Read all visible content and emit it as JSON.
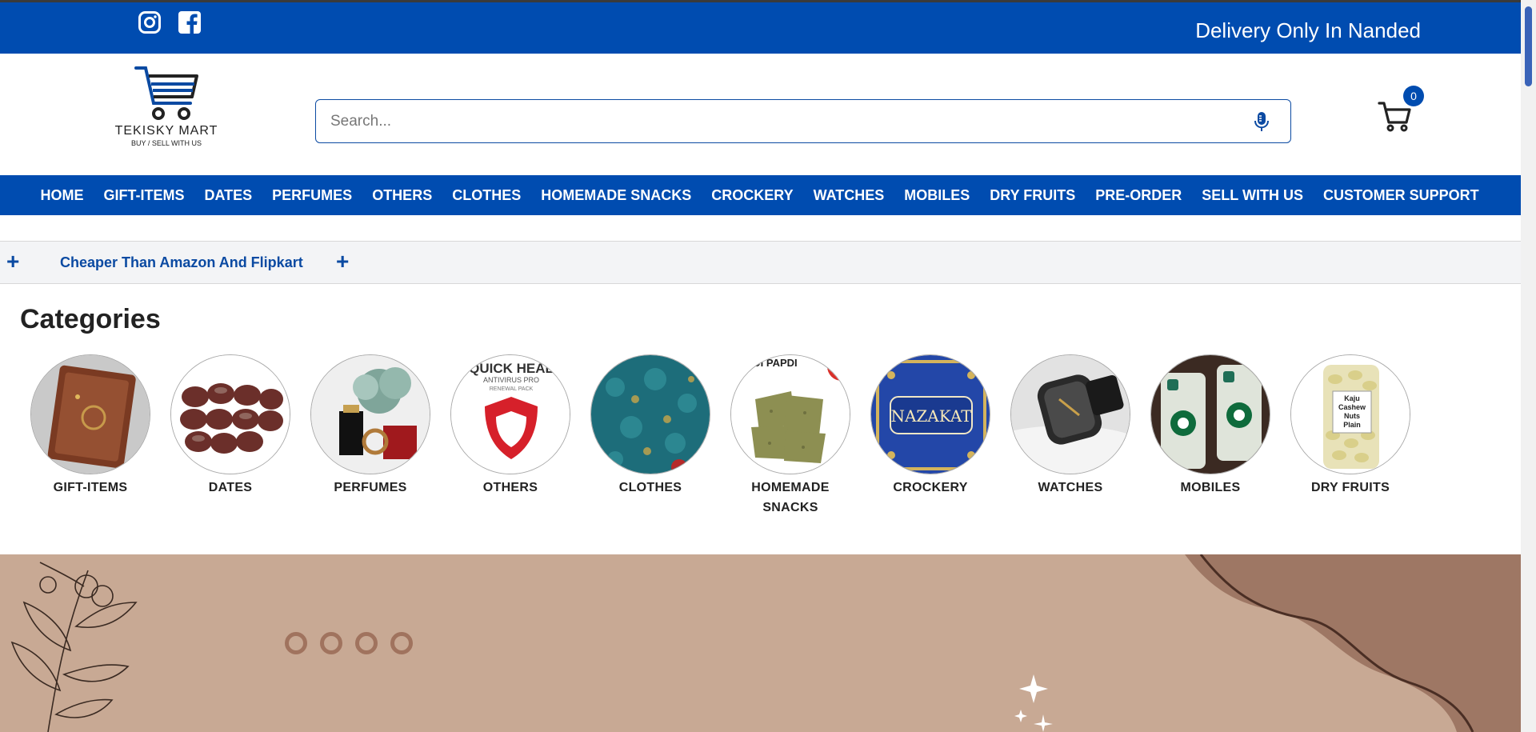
{
  "topbar": {
    "delivery_text": "Delivery Only In Nanded",
    "social_icons": [
      "instagram-icon",
      "facebook-icon"
    ],
    "color": "#004cb0"
  },
  "logo": {
    "name": "TEKISKY MART",
    "tagline": "BUY / SELL WITH US"
  },
  "search": {
    "placeholder": "Search...",
    "value": "",
    "icon": "microphone-icon"
  },
  "cart": {
    "count": "0",
    "icon": "shopping-cart-icon"
  },
  "nav": {
    "items": [
      "HOME",
      "GIFT-ITEMS",
      "DATES",
      "PERFUMES",
      "OTHERS",
      "CLOTHES",
      "HOMEMADE SNACKS",
      "CROCKERY",
      "WATCHES",
      "MOBILES",
      "DRY FRUITS",
      "PRE-ORDER",
      "SELL WITH US",
      "CUSTOMER SUPPORT"
    ]
  },
  "promo": {
    "text": "Cheaper Than Amazon And Flipkart",
    "left_icon": "+",
    "right_icon": "+"
  },
  "categories": {
    "title": "Categories",
    "items": [
      {
        "label": "GIFT-ITEMS",
        "label2": ""
      },
      {
        "label": "DATES",
        "label2": ""
      },
      {
        "label": "PERFUMES",
        "label2": ""
      },
      {
        "label": "OTHERS",
        "label2": "",
        "image_text": "QUICK HEAL",
        "image_subtext": "ANTIVIRUS PRO",
        "image_subtext2": "RENEWAL PACK"
      },
      {
        "label": "CLOTHES",
        "label2": ""
      },
      {
        "label": "HOMEMADE",
        "label2": "SNACKS",
        "image_text": "DI PAPDI"
      },
      {
        "label": "CROCKERY",
        "label2": "",
        "image_text": "NAZAKAT"
      },
      {
        "label": "WATCHES",
        "label2": ""
      },
      {
        "label": "MOBILES",
        "label2": ""
      },
      {
        "label": "DRY FRUITS",
        "label2": "",
        "image_text": "Kaju",
        "image_subtext": "Cashew",
        "image_subtext2": "Nuts",
        "image_subtext3": "Plain"
      }
    ]
  },
  "banner": {
    "background_color": "#c8a994",
    "accent_color": "#a0735e"
  }
}
